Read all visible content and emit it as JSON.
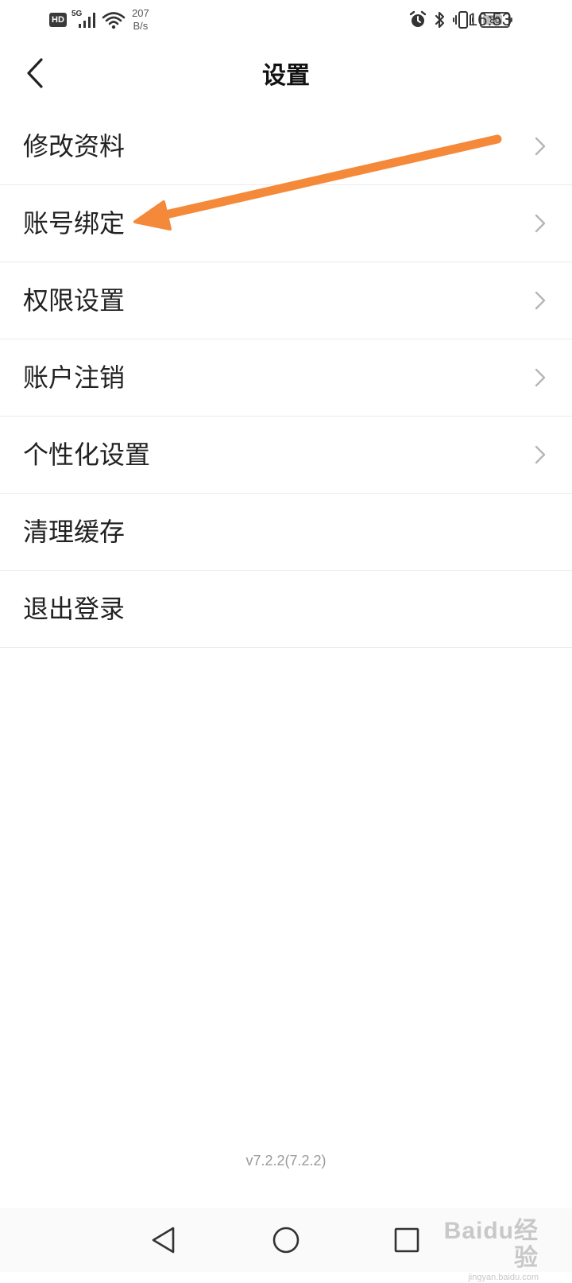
{
  "status_bar": {
    "hd_label": "HD",
    "network_gen": "5G",
    "net_speed_value": "207",
    "net_speed_unit": "B/s",
    "battery_level": "80",
    "battery_fraction": 0.8,
    "time": "16:53",
    "icons": [
      "hd-badge",
      "signal-5g-icon",
      "wifi-icon",
      "alarm-icon",
      "bluetooth-icon",
      "vibrate-icon",
      "battery-icon"
    ]
  },
  "header": {
    "title": "设置",
    "back_icon": "chevron-left-icon"
  },
  "settings": {
    "items": [
      {
        "label": "修改资料",
        "has_chevron": true
      },
      {
        "label": "账号绑定",
        "has_chevron": true
      },
      {
        "label": "权限设置",
        "has_chevron": true
      },
      {
        "label": "账户注销",
        "has_chevron": true
      },
      {
        "label": "个性化设置",
        "has_chevron": true
      },
      {
        "label": "清理缓存",
        "has_chevron": false
      },
      {
        "label": "退出登录",
        "has_chevron": false
      }
    ]
  },
  "annotation": {
    "type": "arrow",
    "color": "#f5893a",
    "points_to": "账号绑定"
  },
  "footer": {
    "version": "v7.2.2(7.2.2)"
  },
  "nav_bar": {
    "icons": [
      "nav-back-icon",
      "nav-home-icon",
      "nav-recent-icon"
    ]
  },
  "watermark": {
    "brand": "Baidu经验",
    "site": "jingyan.baidu.com"
  }
}
